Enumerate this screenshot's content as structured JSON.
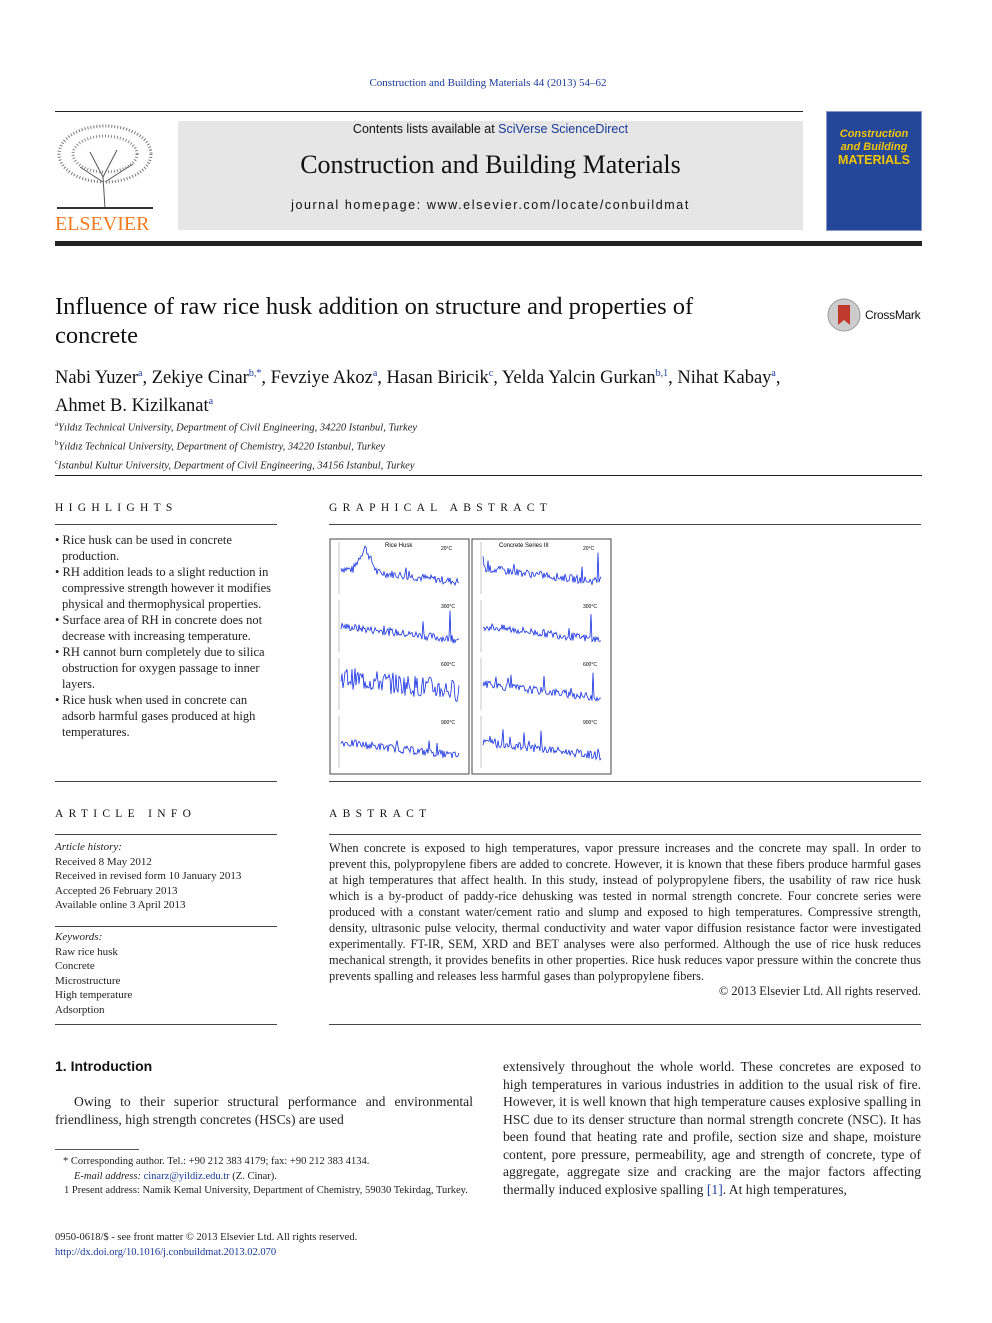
{
  "header": {
    "citation": "Construction and Building Materials 44 (2013) 54–62",
    "contents_prefix": "Contents lists available at ",
    "contents_link": "SciVerse ScienceDirect",
    "journal": "Construction and Building Materials",
    "homepage": "journal homepage: www.elsevier.com/locate/conbuildmat",
    "publisher": "ELSEVIER",
    "cover_line1": "Construction",
    "cover_line2": "and Building",
    "cover_line3": "MATERIALS"
  },
  "article": {
    "title": "Influence of raw rice husk addition on structure and properties of concrete",
    "crossmark": "CrossMark",
    "authors": [
      {
        "name": "Nabi Yuzer",
        "sup": "a"
      },
      {
        "name": "Zekiye Cinar",
        "sup": "b,*"
      },
      {
        "name": "Fevziye Akoz",
        "sup": "a"
      },
      {
        "name": "Hasan Biricik",
        "sup": "c"
      },
      {
        "name": "Yelda Yalcin Gurkan",
        "sup": "b,1"
      },
      {
        "name": "Nihat Kabay",
        "sup": "a"
      },
      {
        "name": "Ahmet B. Kizilkanat",
        "sup": "a"
      }
    ],
    "affiliations": [
      {
        "sup": "a",
        "text": "Yıldız Technical University, Department of Civil Engineering, 34220 Istanbul, Turkey"
      },
      {
        "sup": "b",
        "text": "Yıldız Technical University, Department of Chemistry, 34220 Istanbul, Turkey"
      },
      {
        "sup": "c",
        "text": "Istanbul Kultur University, Department of Civil Engineering, 34156 Istanbul, Turkey"
      }
    ]
  },
  "highlights": {
    "heading": "HIGHLIGHTS",
    "items": [
      "Rice husk can be used in concrete production.",
      "RH addition leads to a slight reduction in compressive strength however it modifies physical and thermophysical properties.",
      "Surface area of RH in concrete does not decrease with increasing temperature.",
      "RH cannot burn completely due to silica obstruction for oxygen passage to inner layers.",
      "Rice husk when used in concrete can adsorb harmful gases produced at high temperatures."
    ]
  },
  "graphical_abstract": {
    "heading": "GRAPHICAL ABSTRACT",
    "left_title": "Rice Husk",
    "right_title": "Concrete Series III",
    "temps": [
      "20°C",
      "300°C",
      "600°C",
      "900°C"
    ]
  },
  "article_info": {
    "heading": "ARTICLE INFO",
    "history_label": "Article history:",
    "history": [
      "Received 8 May 2012",
      "Received in revised form 10 January 2013",
      "Accepted 26 February 2013",
      "Available online 3 April 2013"
    ],
    "keywords_label": "Keywords:",
    "keywords": [
      "Raw rice husk",
      "Concrete",
      "Microstructure",
      "High temperature",
      "Adsorption"
    ]
  },
  "abstract": {
    "heading": "ABSTRACT",
    "text": "When concrete is exposed to high temperatures, vapor pressure increases and the concrete may spall. In order to prevent this, polypropylene fibers are added to concrete. However, it is known that these fibers produce harmful gases at high temperatures that affect health. In this study, instead of polypropylene fibers, the usability of raw rice husk which is a by-product of paddy-rice dehusking was tested in normal strength concrete. Four concrete series were produced with a constant water/cement ratio and slump and exposed to high temperatures. Compressive strength, density, ultrasonic pulse velocity, thermal conductivity and water vapor diffusion resistance factor were investigated experimentally. FT-IR, SEM, XRD and BET analyses were also performed. Although the use of rice husk reduces mechanical strength, it provides benefits in other properties. Rice husk reduces vapor pressure within the concrete thus prevents spalling and releases less harmful gases than polypropylene fibers.",
    "copyright": "© 2013 Elsevier Ltd. All rights reserved."
  },
  "intro": {
    "heading": "1. Introduction",
    "left": "Owing to their superior structural performance and environmental friendliness, high strength concretes (HSCs) are used",
    "right_a": "extensively throughout the whole world. These concretes are exposed to high temperatures in various industries in addition to the usual risk of fire. However, it is well known that high temperature causes explosive spalling in HSC due to its denser structure than normal strength concrete (NSC). It has been found that heating rate and profile, section size and shape, moisture content, pore pressure, permeability, age and strength of concrete, type of aggregate, aggregate size and cracking are the major factors affecting thermally induced explosive spalling ",
    "ref": "[1]",
    "right_b": ". At high temperatures,"
  },
  "footnotes": {
    "corr": "* Corresponding author. Tel.: +90 212 383 4179; fax: +90 212 383 4134.",
    "email_label": "E-mail address: ",
    "email": "cinarz@yildiz.edu.tr",
    "email_suffix": " (Z. Cinar).",
    "present": "1 Present address: Namik Kemal University, Department of Chemistry, 59030 Tekirdag, Turkey."
  },
  "bottom": {
    "issn": "0950-0618/$ - see front matter © 2013 Elsevier Ltd. All rights reserved.",
    "doi": "http://dx.doi.org/10.1016/j.conbuildmat.2013.02.070"
  }
}
